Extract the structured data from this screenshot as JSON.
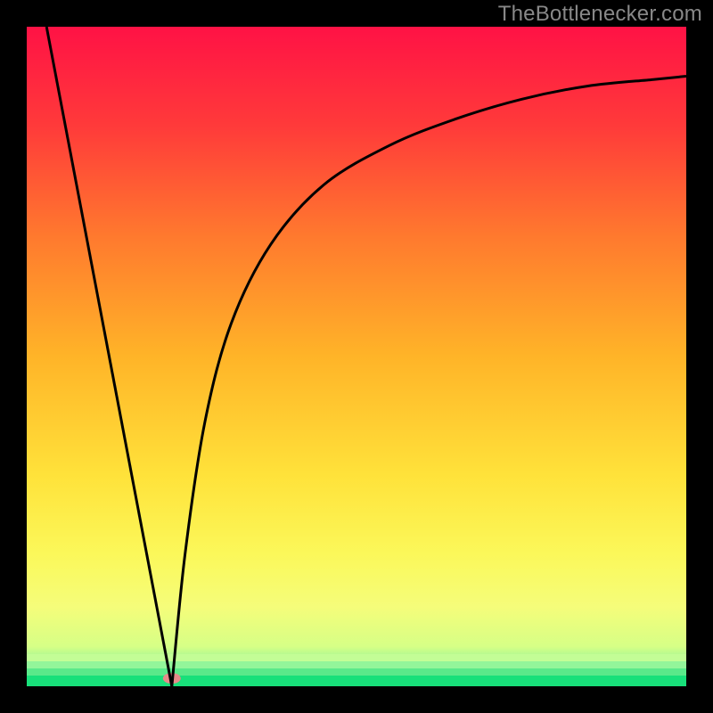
{
  "watermark": "TheBottlenecker.com",
  "chart_data": {
    "type": "line",
    "title": "",
    "xlabel": "",
    "ylabel": "",
    "xlim": [
      0,
      100
    ],
    "ylim": [
      0,
      100
    ],
    "gradient_stops": [
      {
        "offset": 0.0,
        "color": "#ff1245"
      },
      {
        "offset": 0.15,
        "color": "#ff3a3a"
      },
      {
        "offset": 0.32,
        "color": "#ff7a2e"
      },
      {
        "offset": 0.5,
        "color": "#ffb428"
      },
      {
        "offset": 0.68,
        "color": "#ffe23a"
      },
      {
        "offset": 0.8,
        "color": "#fbf85a"
      },
      {
        "offset": 0.88,
        "color": "#f5fd7a"
      },
      {
        "offset": 0.94,
        "color": "#d6ff86"
      },
      {
        "offset": 0.965,
        "color": "#93f59a"
      },
      {
        "offset": 1.0,
        "color": "#18e07a"
      }
    ],
    "optimal_point": {
      "x": 22,
      "y": 0
    },
    "curve_left": {
      "description": "linear descent from top-left to optimal point",
      "points": [
        {
          "x": 3,
          "y": 100
        },
        {
          "x": 22,
          "y": 0
        }
      ]
    },
    "curve_right": {
      "description": "steep rise from optimal point then asymptotic flatten toward top-right",
      "points": [
        {
          "x": 22,
          "y": 0
        },
        {
          "x": 24,
          "y": 20
        },
        {
          "x": 27,
          "y": 40
        },
        {
          "x": 31,
          "y": 55
        },
        {
          "x": 37,
          "y": 67
        },
        {
          "x": 45,
          "y": 76
        },
        {
          "x": 55,
          "y": 82
        },
        {
          "x": 65,
          "y": 86
        },
        {
          "x": 75,
          "y": 89
        },
        {
          "x": 85,
          "y": 91
        },
        {
          "x": 95,
          "y": 92
        },
        {
          "x": 100,
          "y": 92.5
        }
      ]
    },
    "marker": {
      "x": 22,
      "y": 1.2,
      "color": "#e68a8a",
      "rx": 10,
      "ry": 6
    }
  }
}
